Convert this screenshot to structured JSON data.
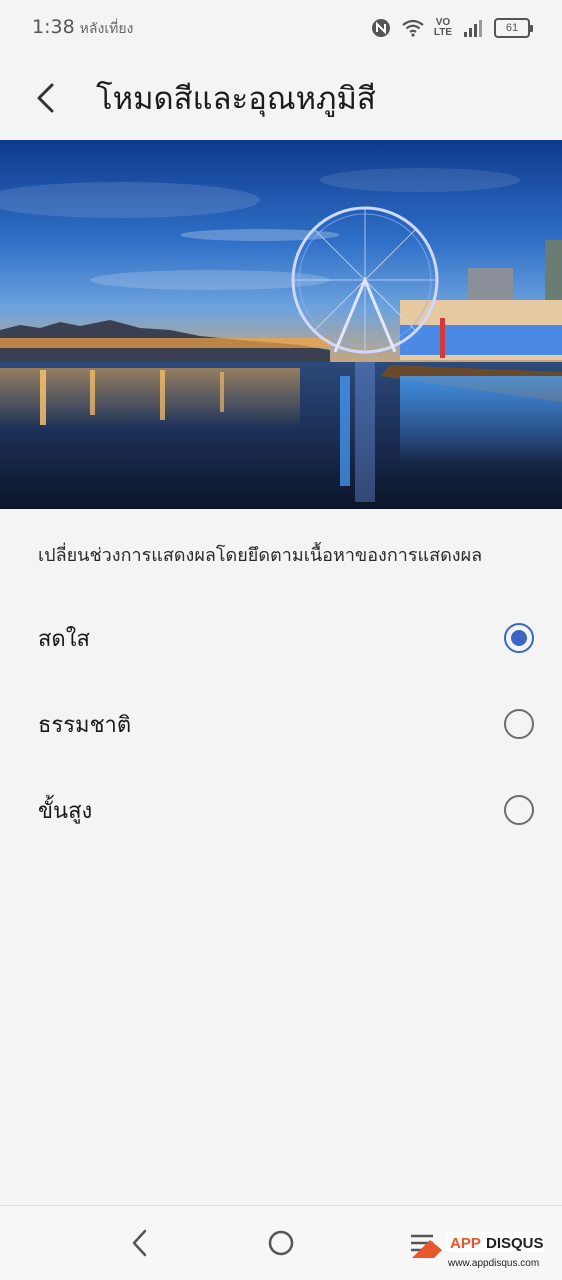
{
  "status_bar": {
    "time": "1:38",
    "time_suffix": "หลังเที่ยง",
    "network_top": "VO",
    "network_bottom": "LTE",
    "battery": "61",
    "icons": [
      "nfc-icon",
      "wifi-icon",
      "volte-icon",
      "signal-icon",
      "battery-icon"
    ]
  },
  "header": {
    "title": "โหมดสีและอุณหภูมิสี",
    "back_icon": "back-arrow-icon"
  },
  "hero": {
    "description": "London Eye night river scene preview image"
  },
  "description": "เปลี่ยนช่วงการแสดงผลโดยยึดตามเนื้อหาของการแสดงผล",
  "options": [
    {
      "label": "สดใส",
      "selected": true
    },
    {
      "label": "ธรรมชาติ",
      "selected": false
    },
    {
      "label": "ขั้นสูง",
      "selected": false
    }
  ],
  "nav_bar": {
    "icons": [
      "nav-back-icon",
      "nav-home-icon",
      "nav-menu-icon"
    ]
  },
  "watermark": {
    "brand": "APPDISQUS",
    "url": "www.appdisqus.com"
  },
  "colors": {
    "accent": "#3b66c4",
    "background": "#f4f4f4"
  }
}
